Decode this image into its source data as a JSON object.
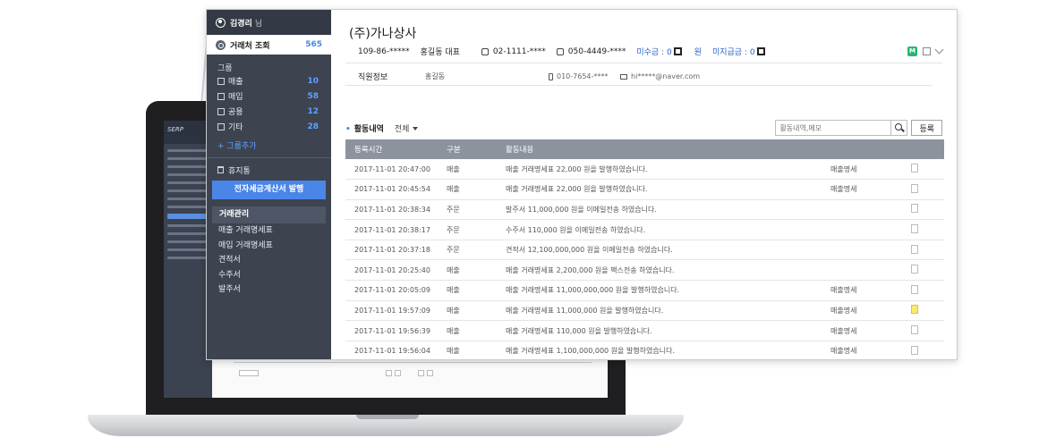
{
  "laptop": {
    "logo": "SERP"
  },
  "sidebar": {
    "user": {
      "name": "김경리",
      "suffix": "님"
    },
    "active_menu": {
      "label": "거래처 조회",
      "count": "565"
    },
    "group_title": "그룹",
    "groups": [
      {
        "label": "매출",
        "count": "10"
      },
      {
        "label": "매입",
        "count": "58"
      },
      {
        "label": "공용",
        "count": "12"
      },
      {
        "label": "기타",
        "count": "28"
      }
    ],
    "add_group": "+ 그룹추가",
    "trash": "휴지통",
    "issue_button": "전자세금계산서 발행",
    "trade_title": "거래관리",
    "trade_items": [
      "매출 거래명세표",
      "매입 거래명세표",
      "견적서",
      "수주서",
      "발주서"
    ]
  },
  "company": {
    "name": "(주)가나상사",
    "biz_no": "109-86-*****",
    "ceo": "홍길동 대표",
    "phone": "02-1111-****",
    "fax": "050-4449-****",
    "receivable_label": "미수금 : 0",
    "receivable_unit": "원",
    "payable_label": "미지급금 : 0",
    "badge": "M"
  },
  "staff": {
    "label": "직원정보",
    "name": "홍길동",
    "phone": "010-7654-****",
    "email": "hi*****@naver.com"
  },
  "activity": {
    "title": "활동내역",
    "filter": "전체",
    "search_placeholder": "활동내역,메모",
    "register_button": "등록",
    "columns": [
      "등록시간",
      "구분",
      "활동내용",
      "",
      ""
    ],
    "rows": [
      {
        "time": "2017-11-01 20:47:00",
        "type": "매출",
        "content": "매출 거래명세표 22,000 원을 발행하였습니다.",
        "doc": "매출명세",
        "highlight": false
      },
      {
        "time": "2017-11-01 20:45:54",
        "type": "매출",
        "content": "매출 거래명세표 22,000 원을 발행하였습니다.",
        "doc": "매출명세",
        "highlight": false
      },
      {
        "time": "2017-11-01 20:38:34",
        "type": "주문",
        "content": "발주서 11,000,000 원을 이메일전송 하였습니다.",
        "doc": "",
        "highlight": false
      },
      {
        "time": "2017-11-01 20:38:17",
        "type": "주문",
        "content": "수주서 110,000 원을 이메일전송 하였습니다.",
        "doc": "",
        "highlight": false
      },
      {
        "time": "2017-11-01 20:37:18",
        "type": "주문",
        "content": "견적서 12,100,000,000 원을 이메일전송 하였습니다.",
        "doc": "",
        "highlight": false
      },
      {
        "time": "2017-11-01 20:25:40",
        "type": "매출",
        "content": "매출 거래명세표 2,200,000 원을 팩스전송 하였습니다.",
        "doc": "",
        "highlight": false
      },
      {
        "time": "2017-11-01 20:05:09",
        "type": "매출",
        "content": "매출 거래명세표 11,000,000,000 원을 발행하였습니다.",
        "doc": "매출명세",
        "highlight": false
      },
      {
        "time": "2017-11-01 19:57:09",
        "type": "매출",
        "content": "매출 거래명세표 11,000,000 원을 발행하였습니다.",
        "doc": "매출명세",
        "highlight": true
      },
      {
        "time": "2017-11-01 19:56:39",
        "type": "매출",
        "content": "매출 거래명세표 110,000 원을 발행하였습니다.",
        "doc": "매출명세",
        "highlight": false
      },
      {
        "time": "2017-11-01 19:56:04",
        "type": "매출",
        "content": "매출 거래명세표 1,100,000,000 원을 발행하였습니다.",
        "doc": "매출명세",
        "highlight": false
      }
    ]
  }
}
